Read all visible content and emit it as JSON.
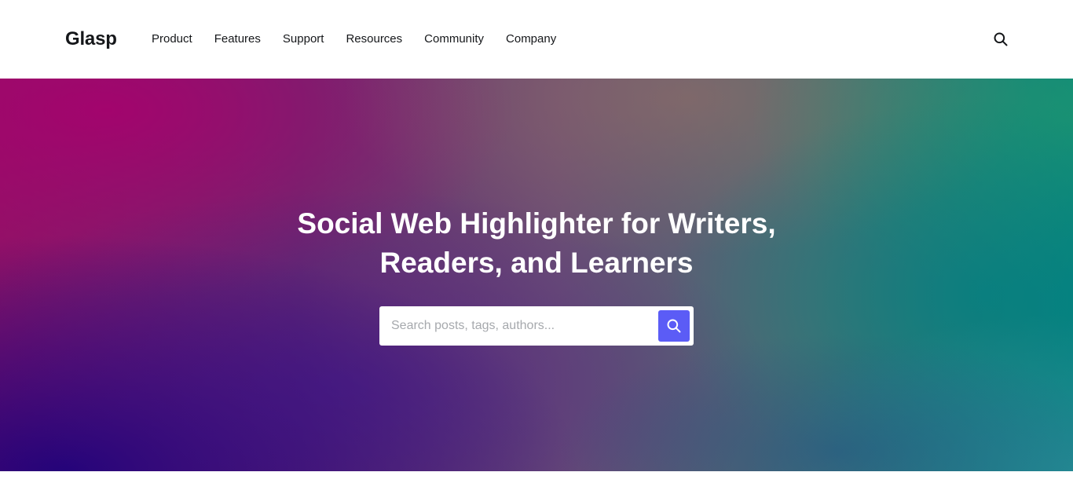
{
  "header": {
    "logo": "Glasp",
    "nav": [
      {
        "label": "Product"
      },
      {
        "label": "Features"
      },
      {
        "label": "Support"
      },
      {
        "label": "Resources"
      },
      {
        "label": "Community"
      },
      {
        "label": "Company"
      }
    ],
    "search_icon": "search-icon"
  },
  "hero": {
    "title_line1": "Social Web Highlighter for Writers,",
    "title_line2": "Readers, and Learners",
    "search": {
      "placeholder": "Search posts, tags, authors...",
      "value": "",
      "button_icon": "search-icon"
    }
  },
  "colors": {
    "accent": "#5b5cf6",
    "text": "#15171a",
    "hero_gradient": [
      "#a3006e",
      "#1c0078",
      "#6c4f74",
      "#008080"
    ]
  }
}
